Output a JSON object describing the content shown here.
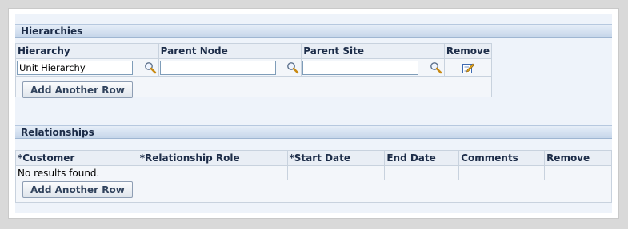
{
  "hierarchies": {
    "section_title": "Hierarchies",
    "columns": [
      "Hierarchy",
      "Parent Node",
      "Parent Site",
      "Remove"
    ],
    "row": {
      "hierarchy_value": "Unit Hierarchy",
      "parent_node_value": "",
      "parent_site_value": ""
    },
    "add_row_label": "Add Another Row"
  },
  "relationships": {
    "section_title": "Relationships",
    "columns": [
      "*Customer",
      "*Relationship Role",
      "*Start Date",
      "End Date",
      "Comments",
      "Remove"
    ],
    "empty_message": "No results found.",
    "add_row_label": "Add Another Row"
  },
  "icons": {
    "lov": "search-icon",
    "remove": "edit-remove-icon"
  },
  "colors": {
    "header_text": "#1c2c48",
    "panel_bg": "#eef3fa",
    "header_bg": "#c6d6ea"
  }
}
